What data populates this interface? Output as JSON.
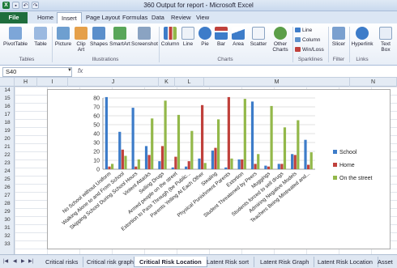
{
  "window": {
    "title": "360 Output for report - Microsoft Excel"
  },
  "ribbon_tabs": [
    "File",
    "Home",
    "Insert",
    "Page Layout",
    "Formulas",
    "Data",
    "Review",
    "View"
  ],
  "active_tab": "Insert",
  "ribbon": {
    "pivottable": "PivotTable",
    "table": "Table",
    "picture": "Picture",
    "clipart": "Clip Art",
    "shapes": "Shapes",
    "smartart": "SmartArt",
    "screenshot": "Screenshot",
    "column": "Column",
    "line": "Line",
    "pie": "Pie",
    "bar": "Bar",
    "area": "Area",
    "scatter": "Scatter",
    "other": "Other Charts",
    "spark_line": "Line",
    "spark_column": "Column",
    "spark_winloss": "Win/Loss",
    "slicer": "Slicer",
    "hyperlink": "Hyperlink",
    "textbox": "Text Box",
    "groups": {
      "tables": "Tables",
      "illustrations": "Illustrations",
      "charts": "Charts",
      "sparklines": "Sparklines",
      "filter": "Filter",
      "links": "Links"
    }
  },
  "formula_bar": {
    "name_box": "S40",
    "fx": "fx",
    "dropdown": "▼"
  },
  "columns": [
    "H",
    "I",
    "J",
    "K",
    "L",
    "M",
    "N"
  ],
  "rows": [
    "14",
    "15",
    "16",
    "17",
    "18",
    "19",
    "20",
    "21",
    "22",
    "23",
    "24",
    "25",
    "26",
    "27",
    "28",
    "29",
    "30",
    "31",
    "32",
    "33"
  ],
  "chart_data": {
    "type": "bar",
    "categories": [
      "No School without Uniform",
      "Walking Alone to and From School",
      "Skipping School During School Hours",
      "Violent Attacks",
      "Selling Drugs",
      "Armed people on the street",
      "Extortion to Pass Through (be Public...",
      "Parents Yelling At Each Other",
      "Stealing",
      "Physical Punishment Parents",
      "Extortion",
      "Student Threatened by Peers",
      "Muggings",
      "Students forced to sell drugs",
      "Admiring Negative Models",
      "Teachers Being Mistreated and..."
    ],
    "series": [
      {
        "name": "School",
        "color": "#3d7cc9",
        "values": [
          81,
          42,
          69,
          26,
          9,
          2,
          3,
          12,
          21,
          2,
          11,
          76,
          4,
          6,
          17,
          33
        ]
      },
      {
        "name": "Home",
        "color": "#c0413c",
        "values": [
          3,
          22,
          3,
          16,
          26,
          14,
          9,
          72,
          24,
          81,
          11,
          6,
          3,
          6,
          16,
          5
        ]
      },
      {
        "name": "On the street",
        "color": "#93b84a",
        "values": [
          6,
          15,
          11,
          57,
          77,
          61,
          43,
          7,
          56,
          12,
          79,
          17,
          71,
          47,
          55,
          19
        ]
      }
    ],
    "ylim": [
      0,
      80
    ],
    "yticks": [
      "0",
      "10",
      "20",
      "30",
      "40",
      "50",
      "60",
      "70",
      "80"
    ],
    "legend_position": "right",
    "grid": true
  },
  "sheet_tabs": [
    "Critical risks",
    "Critical risk graph",
    "Critical Risk Location",
    "Latent Risk sort",
    "Latent Risk Graph",
    "Latent Risk Location",
    "Asset"
  ],
  "active_sheet": "Critical Risk Location"
}
